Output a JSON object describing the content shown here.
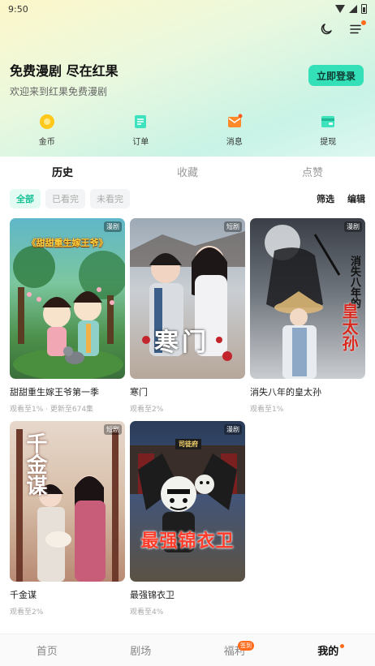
{
  "status_bar": {
    "time": "9:50"
  },
  "header": {
    "promo_title": "免费漫剧 尽在红果",
    "promo_subtitle": "欢迎来到红果免费漫剧",
    "login_button": "立即登录",
    "icons": [
      "moon-icon",
      "menu-icon"
    ]
  },
  "quick_actions": [
    {
      "label": "金币",
      "icon": "coin-icon"
    },
    {
      "label": "订单",
      "icon": "order-icon"
    },
    {
      "label": "消息",
      "icon": "message-icon"
    },
    {
      "label": "提现",
      "icon": "withdraw-icon"
    }
  ],
  "tabs": [
    {
      "label": "历史",
      "active": true
    },
    {
      "label": "收藏",
      "active": false
    },
    {
      "label": "点赞",
      "active": false
    }
  ],
  "filters": {
    "chips": [
      {
        "label": "全部",
        "active": true
      },
      {
        "label": "已看完",
        "active": false
      },
      {
        "label": "未看完",
        "active": false
      }
    ],
    "select_label": "筛选",
    "edit_label": "编辑"
  },
  "items": [
    {
      "title": "甜甜重生嫁王爷第一季",
      "meta": "观看至1% · 更新至674集",
      "badge": "漫剧",
      "poster_text": "《甜甜重生嫁王爷》"
    },
    {
      "title": "寒门",
      "meta": "观看至2%",
      "badge": "短剧",
      "poster_text": "寒门"
    },
    {
      "title": "消失八年的皇太孙",
      "meta": "观看至1%",
      "badge": "漫剧",
      "poster_text_a": "消失八年的",
      "poster_text_b": "皇太孙"
    },
    {
      "title": "千金谋",
      "meta": "观看至2%",
      "badge": "短剧",
      "poster_text": "千金谋"
    },
    {
      "title": "最强锦衣卫",
      "meta": "观看至4%",
      "badge": "漫剧",
      "poster_text": "最强锦衣卫",
      "poster_sign": "司徒府"
    }
  ],
  "bottom_nav": [
    {
      "label": "首页",
      "active": false
    },
    {
      "label": "剧场",
      "active": false
    },
    {
      "label": "福利",
      "active": false,
      "badge": "签到"
    },
    {
      "label": "我的",
      "active": true
    }
  ],
  "colors": {
    "accent": "#33e0b8",
    "active_chip_text": "#17c196",
    "dot": "#ff6b1a"
  }
}
